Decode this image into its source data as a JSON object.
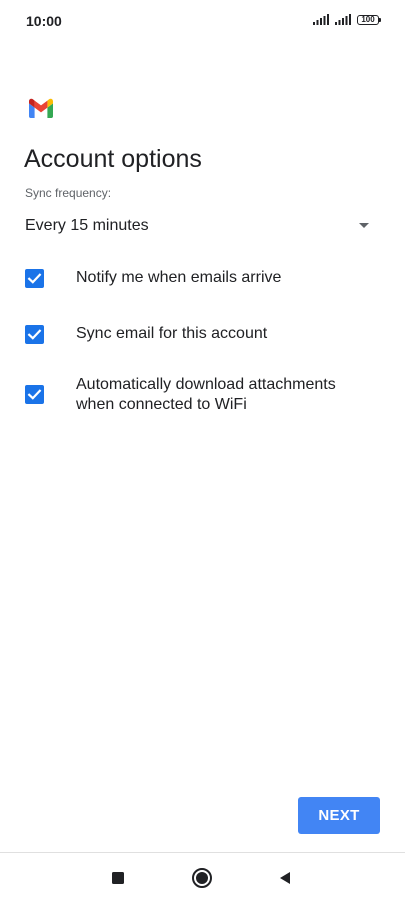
{
  "status_bar": {
    "time": "10:00",
    "battery_level": "100",
    "icons": [
      "signal-icon",
      "signal-icon",
      "battery-icon"
    ]
  },
  "app": {
    "logo": "gmail-logo-icon",
    "brand_colors": [
      "#4285F4",
      "#EA4335",
      "#FBBC04",
      "#34A853",
      "#C5221F"
    ]
  },
  "page": {
    "title": "Account options"
  },
  "sync": {
    "label": "Sync frequency:",
    "selected": "Every 15 minutes",
    "icon": "dropdown-arrow-icon"
  },
  "options": [
    {
      "label": "Notify me when emails arrive",
      "checked": true
    },
    {
      "label": "Sync email for this account",
      "checked": true
    },
    {
      "label": "Automatically download attachments when connected to WiFi",
      "checked": true
    }
  ],
  "actions": {
    "next_label": "NEXT"
  },
  "nav_bar": {
    "icons": [
      "recents-square-icon",
      "home-circle-icon",
      "back-triangle-icon"
    ]
  },
  "colors": {
    "accent": "#1a73e8",
    "button": "#4285f4",
    "text": "#202124",
    "secondary_text": "#5f6368"
  }
}
